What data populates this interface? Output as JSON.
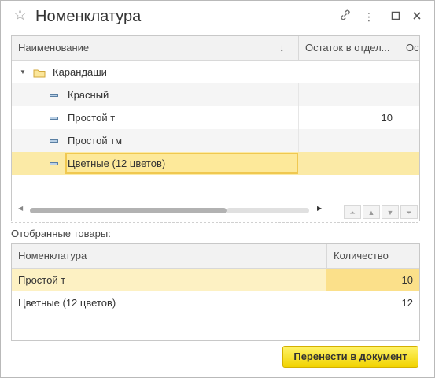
{
  "window": {
    "title": "Номенклатура"
  },
  "toolbar": {
    "icons": [
      "star-icon",
      "link-icon",
      "more-icon",
      "maximize-icon",
      "close-icon"
    ]
  },
  "top_grid": {
    "columns": [
      "Наименование",
      "Остаток в отдел...",
      "Ос"
    ],
    "sort_indicator": "↓",
    "rows": [
      {
        "name": "Карандаши",
        "stock": "",
        "type": "group"
      },
      {
        "name": "Красный",
        "stock": "",
        "type": "item"
      },
      {
        "name": "Простой т",
        "stock": "10",
        "type": "item"
      },
      {
        "name": "Простой тм",
        "stock": "",
        "type": "item"
      },
      {
        "name": "Цветные (12 цветов)",
        "stock": "",
        "type": "item",
        "selected": true
      }
    ]
  },
  "selected_label": "Отобранные товары:",
  "bottom_grid": {
    "columns": [
      "Номенклатура",
      "Количество"
    ],
    "rows": [
      {
        "name": "Простой т",
        "qty": "10",
        "selected": true
      },
      {
        "name": "Цветные (12 цветов)",
        "qty": "12"
      }
    ]
  },
  "actions": {
    "transfer_label": "Перенести в документ"
  },
  "colors": {
    "selection": "#fbeaa6",
    "button": "#f5da1f"
  }
}
